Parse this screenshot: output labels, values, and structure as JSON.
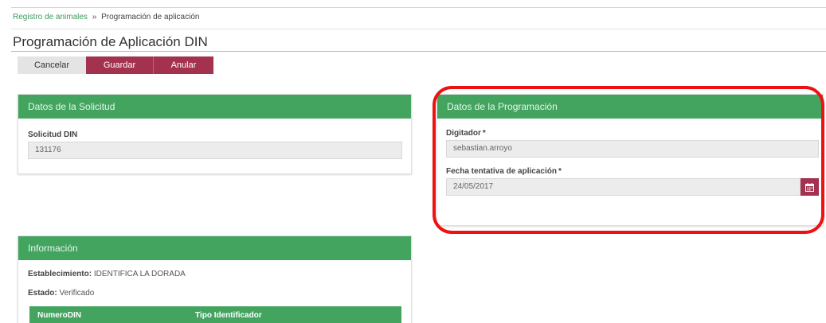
{
  "breadcrumb": {
    "link": "Registro de animales",
    "separator": "»",
    "current": "Programación de aplicación"
  },
  "page": {
    "title": "Programación de Aplicación DIN"
  },
  "toolbar": {
    "cancel_label": "Cancelar",
    "save_label": "Guardar",
    "void_label": "Anular"
  },
  "solicitud_panel": {
    "title": "Datos de la Solicitud",
    "field_label": "Solicitud DIN",
    "field_value": "131176"
  },
  "programacion_panel": {
    "title": "Datos de la Programación",
    "digitador_label": "Digitador",
    "digitador_value": "sebastian.arroyo",
    "fecha_label": "Fecha tentativa de aplicación",
    "fecha_value": "24/05/2017",
    "required_mark": "*",
    "calendar_icon": "calendar-icon"
  },
  "info_panel": {
    "title": "Información",
    "establecimiento_label": "Establecimiento:",
    "establecimiento_value": "IDENTIFICA LA DORADA",
    "estado_label": "Estado:",
    "estado_value": "Verificado",
    "columns": [
      "NumeroDIN",
      "Tipo Identificador"
    ]
  },
  "colors": {
    "panel_header": "#43a460",
    "primary_button": "#a3324f",
    "highlight_border": "#ee1111",
    "link": "#3a9a5b"
  }
}
